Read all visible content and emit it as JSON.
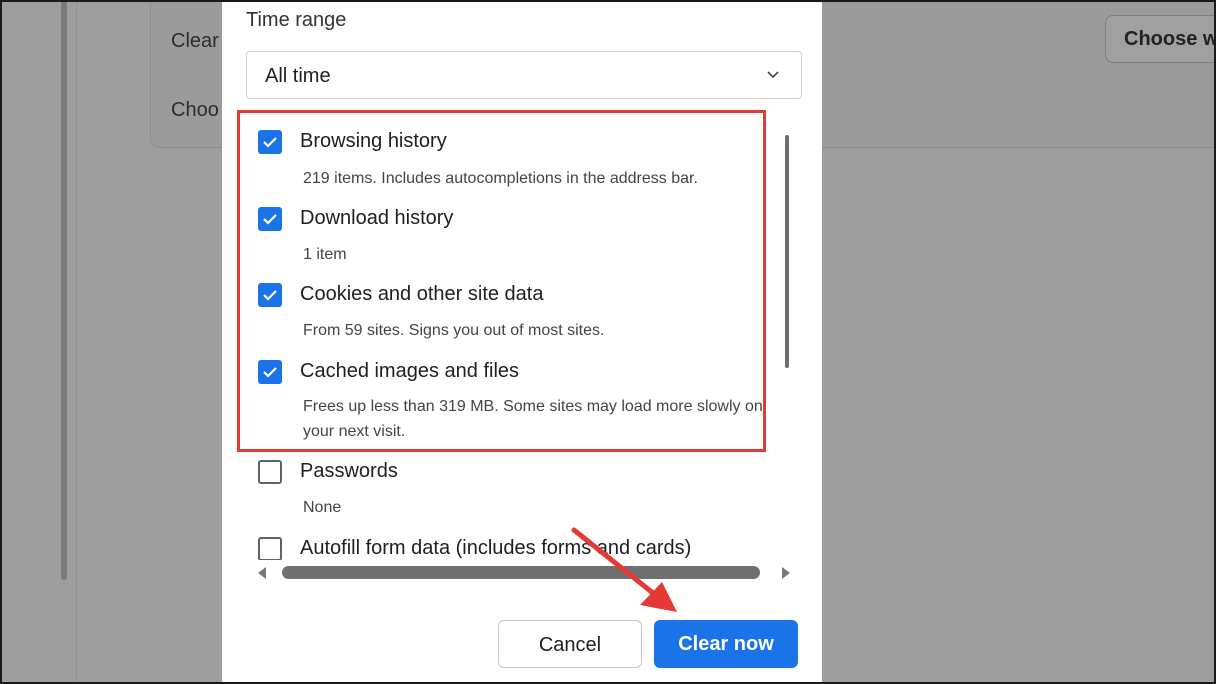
{
  "background": {
    "card_line1": "Clear",
    "card_line2": "Choo",
    "choose_button_label": "Choose w"
  },
  "dialog": {
    "time_range_label": "Time range",
    "time_range_value": "All time",
    "items": [
      {
        "title": "Browsing history",
        "description": "219 items. Includes autocompletions in the address bar.",
        "checked": true
      },
      {
        "title": "Download history",
        "description": "1 item",
        "checked": true
      },
      {
        "title": "Cookies and other site data",
        "description": "From 59 sites. Signs you out of most sites.",
        "checked": true
      },
      {
        "title": "Cached images and files",
        "description": "Frees up less than 319 MB. Some sites may load more slowly on your next visit.",
        "checked": true
      },
      {
        "title": "Passwords",
        "description": "None",
        "checked": false
      },
      {
        "title": "Autofill form data (includes forms and cards)",
        "description": "",
        "checked": false
      }
    ],
    "cancel_label": "Cancel",
    "clear_label": "Clear now"
  },
  "colors": {
    "accent": "#1a73e8",
    "annotation": "#e53935",
    "overlay": "#9e9e9e"
  },
  "icons": {
    "check": "check-icon",
    "chevron": "chevron-down-icon"
  }
}
